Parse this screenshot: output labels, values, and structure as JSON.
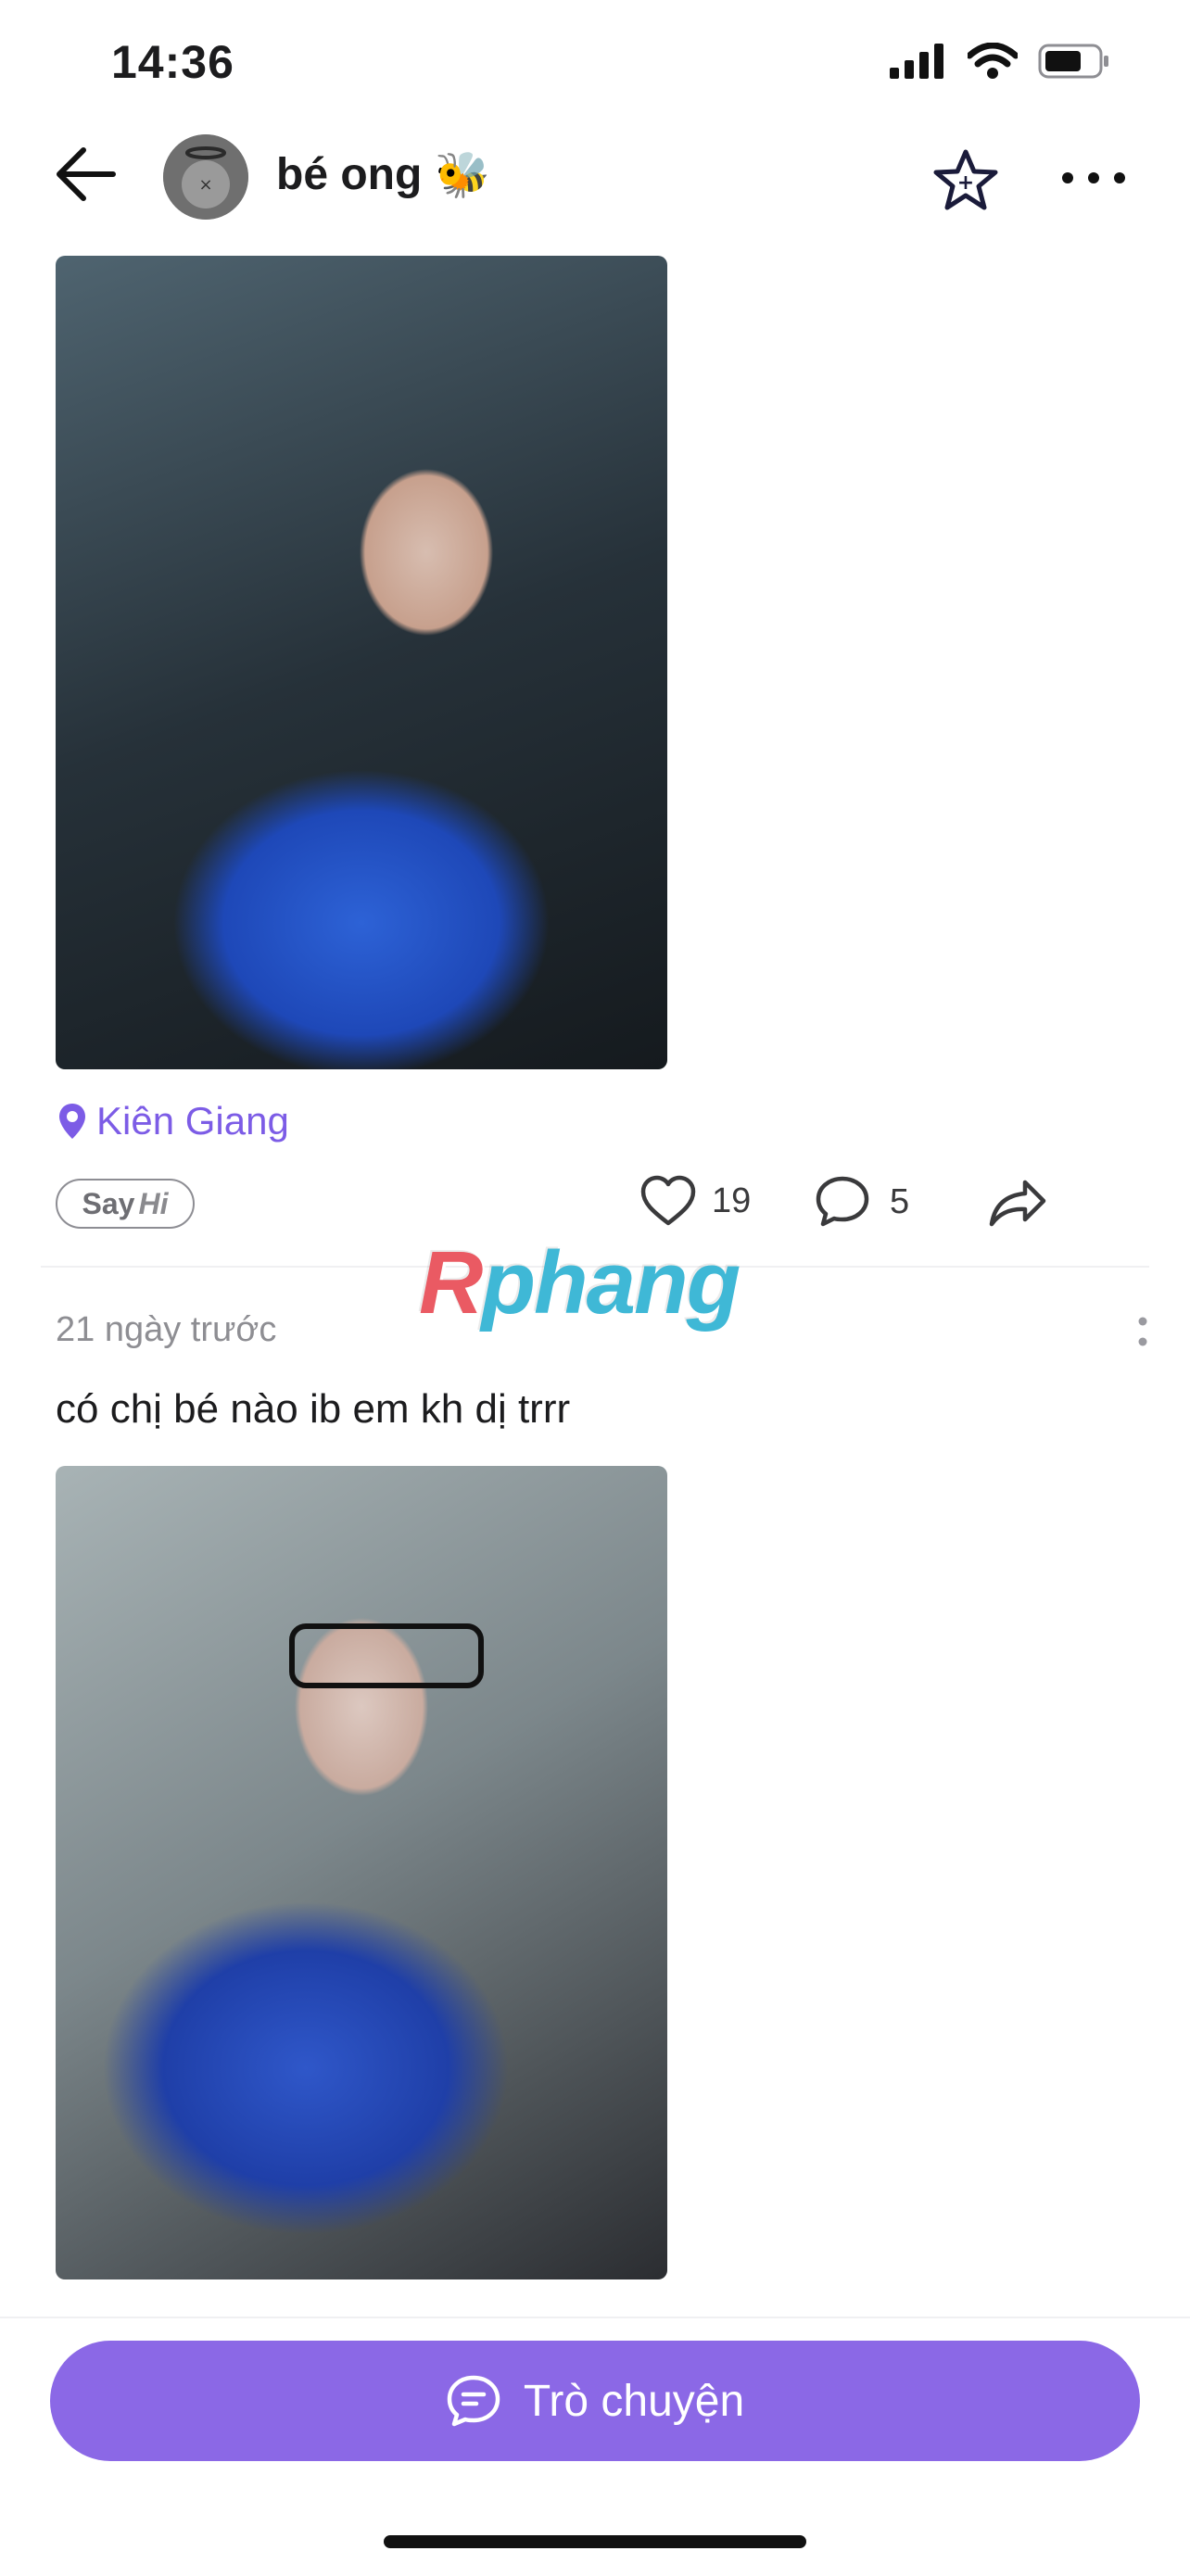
{
  "status_bar": {
    "time": "14:36",
    "icons": [
      "signal-icon",
      "wifi-icon",
      "battery-icon"
    ]
  },
  "header": {
    "back_icon": "arrow-left-icon",
    "name": "bé ong",
    "emoji": "🐝",
    "favorite_icon": "star-icon",
    "more_icon": "more-horizontal-icon"
  },
  "post1": {
    "location": "Kiên Giang",
    "sayhi": {
      "say": "Say",
      "hi": "Hi"
    },
    "likes": "19",
    "comments": "5"
  },
  "watermark": {
    "r": "R",
    "rest": "phang"
  },
  "post2": {
    "time": "21 ngày trước",
    "text": "có chị bé nào ib em kh dị trrr"
  },
  "bottom": {
    "chat_label": "Trò chuyện"
  },
  "colors": {
    "accent": "#8b68e6",
    "location": "#7c5ce6"
  }
}
